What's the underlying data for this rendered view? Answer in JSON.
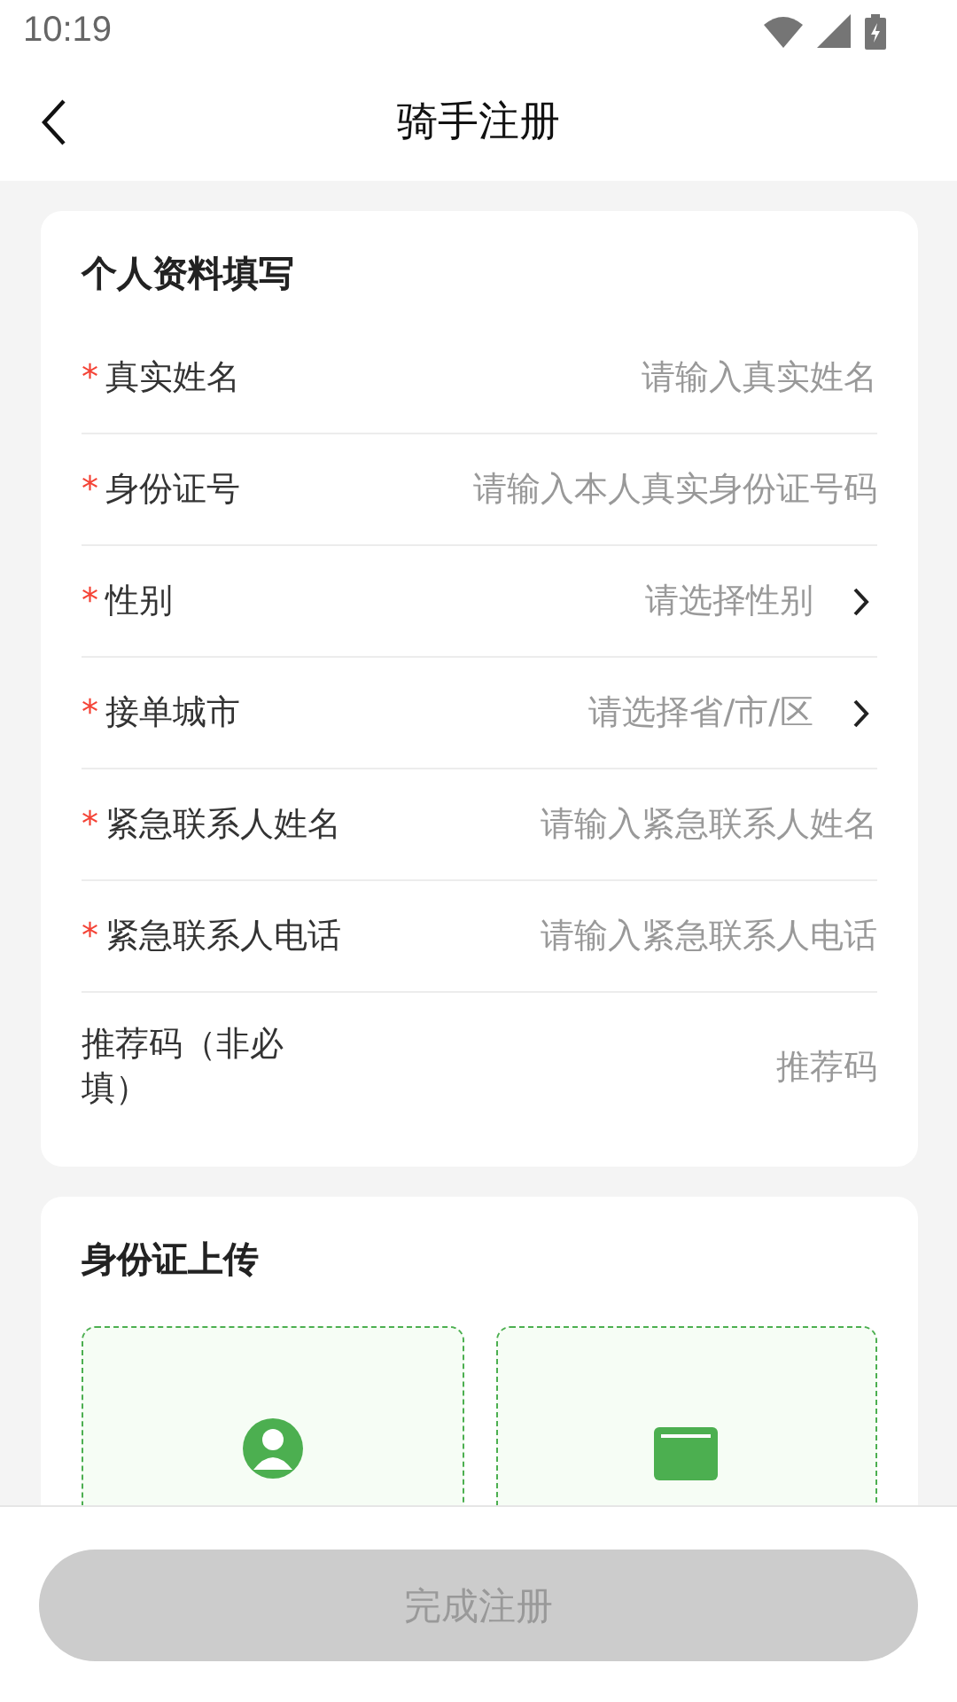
{
  "status_bar": {
    "time": "10:19"
  },
  "header": {
    "title": "骑手注册"
  },
  "profile_section": {
    "title": "个人资料填写",
    "fields": [
      {
        "mark": "*",
        "label": "真实姓名",
        "kind": "input",
        "placeholder": "请输入真实姓名"
      },
      {
        "mark": "*",
        "label": "身份证号",
        "kind": "input",
        "placeholder": "请输入本人真实身份证号码"
      },
      {
        "mark": "*",
        "label": "性别",
        "kind": "select",
        "placeholder": "请选择性别"
      },
      {
        "mark": "*",
        "label": "接单城市",
        "kind": "select",
        "placeholder": "请选择省/市/区"
      },
      {
        "mark": "*",
        "label": "紧急联系人姓名",
        "kind": "input",
        "placeholder": "请输入紧急联系人姓名"
      },
      {
        "mark": "*",
        "label": "紧急联系人电话",
        "kind": "input",
        "placeholder": "请输入紧急联系人电话"
      },
      {
        "label": "推荐码（非必填）",
        "kind": "input",
        "placeholder": "推荐码"
      }
    ]
  },
  "id_upload_section": {
    "title": "身份证上传",
    "slots": [
      {
        "kind": "portrait"
      },
      {
        "kind": "emblem"
      }
    ]
  },
  "submit_button": {
    "label": "完成注册",
    "disabled": true
  }
}
